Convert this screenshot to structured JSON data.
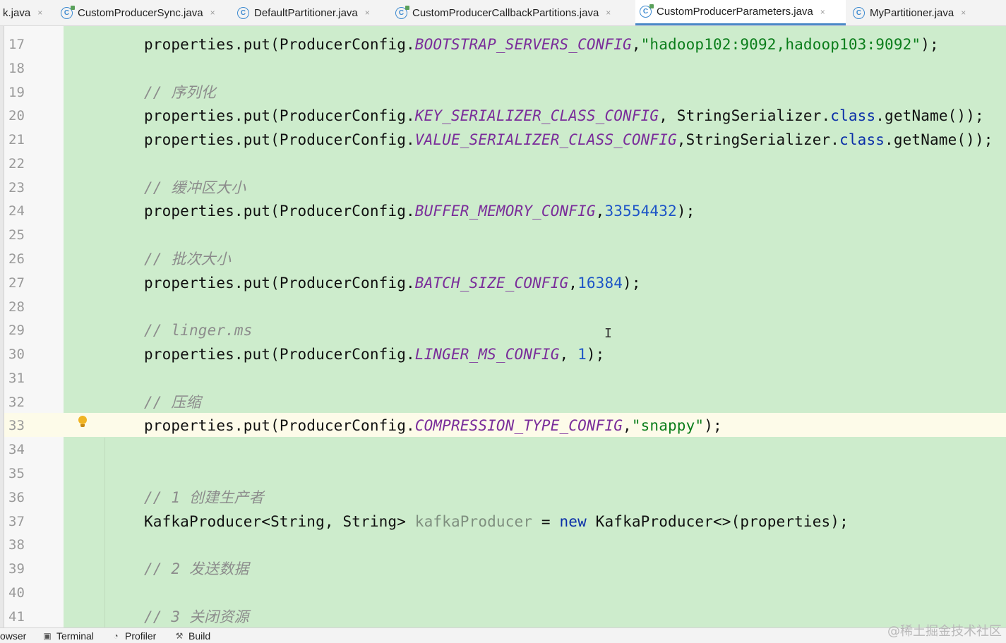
{
  "tabs": [
    {
      "label": "k.java",
      "has_icon": false
    },
    {
      "label": "CustomProducerSync.java",
      "has_icon": true
    },
    {
      "label": "DefaultPartitioner.java",
      "has_icon": true
    },
    {
      "label": "CustomProducerCallbackPartitions.java",
      "has_icon": true
    },
    {
      "label": "CustomProducerParameters.java",
      "has_icon": true,
      "active": true
    },
    {
      "label": "MyPartitioner.java",
      "has_icon": true
    }
  ],
  "tab_icon_letter": "C",
  "tab_close_glyph": "×",
  "lines": [
    {
      "n": "17",
      "code": [
        [
          "properties.put(ProducerConfig.",
          ""
        ],
        [
          "BOOTSTRAP_SERVERS_CONFIG",
          "kw-const"
        ],
        [
          ",",
          ""
        ],
        [
          "\"hadoop102:9092,hadoop103:9092\"",
          "str"
        ],
        [
          ");",
          ""
        ]
      ]
    },
    {
      "n": "18",
      "code": []
    },
    {
      "n": "19",
      "code": [
        [
          "// 序列化",
          "cmt"
        ]
      ]
    },
    {
      "n": "20",
      "code": [
        [
          "properties.put(ProducerConfig.",
          ""
        ],
        [
          "KEY_SERIALIZER_CLASS_CONFIG",
          "kw-const"
        ],
        [
          ", StringSerializer.",
          ""
        ],
        [
          "class",
          "kw"
        ],
        [
          ".getName());",
          ""
        ]
      ]
    },
    {
      "n": "21",
      "code": [
        [
          "properties.put(ProducerConfig.",
          ""
        ],
        [
          "VALUE_SERIALIZER_CLASS_CONFIG",
          "kw-const"
        ],
        [
          ",StringSerializer.",
          ""
        ],
        [
          "class",
          "kw"
        ],
        [
          ".getName());",
          ""
        ]
      ]
    },
    {
      "n": "22",
      "code": []
    },
    {
      "n": "23",
      "code": [
        [
          "// 缓冲区大小",
          "cmt"
        ]
      ]
    },
    {
      "n": "24",
      "code": [
        [
          "properties.put(ProducerConfig.",
          ""
        ],
        [
          "BUFFER_MEMORY_CONFIG",
          "kw-const"
        ],
        [
          ",",
          ""
        ],
        [
          "33554432",
          "num"
        ],
        [
          ");",
          ""
        ]
      ]
    },
    {
      "n": "25",
      "code": []
    },
    {
      "n": "26",
      "code": [
        [
          "// 批次大小",
          "cmt"
        ]
      ]
    },
    {
      "n": "27",
      "code": [
        [
          "properties.put(ProducerConfig.",
          ""
        ],
        [
          "BATCH_SIZE_CONFIG",
          "kw-const"
        ],
        [
          ",",
          ""
        ],
        [
          "16384",
          "num"
        ],
        [
          ");",
          ""
        ]
      ]
    },
    {
      "n": "28",
      "code": []
    },
    {
      "n": "29",
      "code": [
        [
          "// linger.ms",
          "cmt"
        ]
      ]
    },
    {
      "n": "30",
      "code": [
        [
          "properties.put(ProducerConfig.",
          ""
        ],
        [
          "LINGER_MS_CONFIG",
          "kw-const"
        ],
        [
          ", ",
          ""
        ],
        [
          "1",
          "num"
        ],
        [
          ");",
          ""
        ]
      ]
    },
    {
      "n": "31",
      "code": []
    },
    {
      "n": "32",
      "code": [
        [
          "// 压缩",
          "cmt"
        ]
      ]
    },
    {
      "n": "33",
      "code": [
        [
          "properties.put(ProducerConfig.",
          ""
        ],
        [
          "COMPRESSION_TYPE_CONFIG",
          "kw-const"
        ],
        [
          ",",
          ""
        ],
        [
          "\"snappy\"",
          "str"
        ],
        [
          ");",
          ""
        ]
      ]
    },
    {
      "n": "34",
      "code": []
    },
    {
      "n": "35",
      "code": []
    },
    {
      "n": "36",
      "code": [
        [
          "// 1 创建生产者",
          "cmt"
        ]
      ]
    },
    {
      "n": "37",
      "code": [
        [
          "KafkaProducer<String, String> ",
          ""
        ],
        [
          "kafkaProducer",
          "unused"
        ],
        [
          " = ",
          ""
        ],
        [
          "new",
          "kw"
        ],
        [
          " KafkaProducer<>(properties);",
          ""
        ]
      ]
    },
    {
      "n": "38",
      "code": []
    },
    {
      "n": "39",
      "code": [
        [
          "// 2 发送数据",
          "cmt"
        ]
      ]
    },
    {
      "n": "40",
      "code": []
    },
    {
      "n": "41",
      "code": [
        [
          "// 3 关闭资源",
          "cmt"
        ]
      ]
    }
  ],
  "cursor_glyph": "I",
  "bottom_tools": [
    {
      "label": "owser",
      "icon": ""
    },
    {
      "label": "Terminal",
      "icon": "▣"
    },
    {
      "label": "Profiler",
      "icon": "◔"
    },
    {
      "label": "Build",
      "icon": "⚒"
    }
  ],
  "watermark": "@稀土掘金技术社区",
  "colors": {
    "editor_bg": "#cdeccc",
    "current_line": "#fdfbe9",
    "constant": "#7a2d9a",
    "string": "#0a7d1a",
    "number": "#1d55c7",
    "keyword": "#0a2fa8",
    "comment": "#8c8c8c",
    "tab_accent": "#4a88c7"
  }
}
